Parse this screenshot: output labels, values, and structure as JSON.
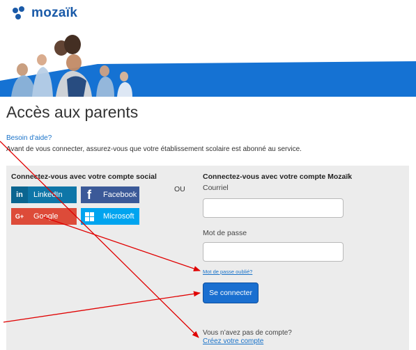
{
  "brand": {
    "name": "mozaïk"
  },
  "page": {
    "title": "Accès aux parents",
    "help_link": "Besoin d'aide?",
    "notice": "Avant de vous connecter, assurez-vous que votre établissement scolaire est abonné au service."
  },
  "social": {
    "heading": "Connectez-vous avec votre compte social",
    "buttons": [
      {
        "label": "LinkedIn",
        "icon": "in",
        "icon_name": "linkedin-icon",
        "color": "#0e76a8"
      },
      {
        "label": "Facebook",
        "icon": "f",
        "icon_name": "facebook-icon",
        "color": "#3b5998"
      },
      {
        "label": "Google",
        "icon": "G+",
        "icon_name": "google-plus-icon",
        "color": "#dd4b39"
      },
      {
        "label": "Microsoft",
        "icon": "windows",
        "icon_name": "windows-icon",
        "color": "#00a4ef"
      }
    ]
  },
  "separator": "OU",
  "mozaik_login": {
    "heading": "Connectez-vous avec votre compte Mozaïk",
    "email_label": "Courriel",
    "email_value": "",
    "password_label": "Mot de passe",
    "password_value": "",
    "forgot_link": "Mot de passe oublié?",
    "submit_label": "Se connecter",
    "no_account_text": "Vous n’avez pas de compte?",
    "create_link": "Créez votre compte"
  },
  "colors": {
    "brand_blue": "#1a5aa8",
    "banner_blue": "#1572d3",
    "panel_bg": "#ececec",
    "link_blue": "#1a73c9",
    "arrow_red": "#e00000"
  }
}
